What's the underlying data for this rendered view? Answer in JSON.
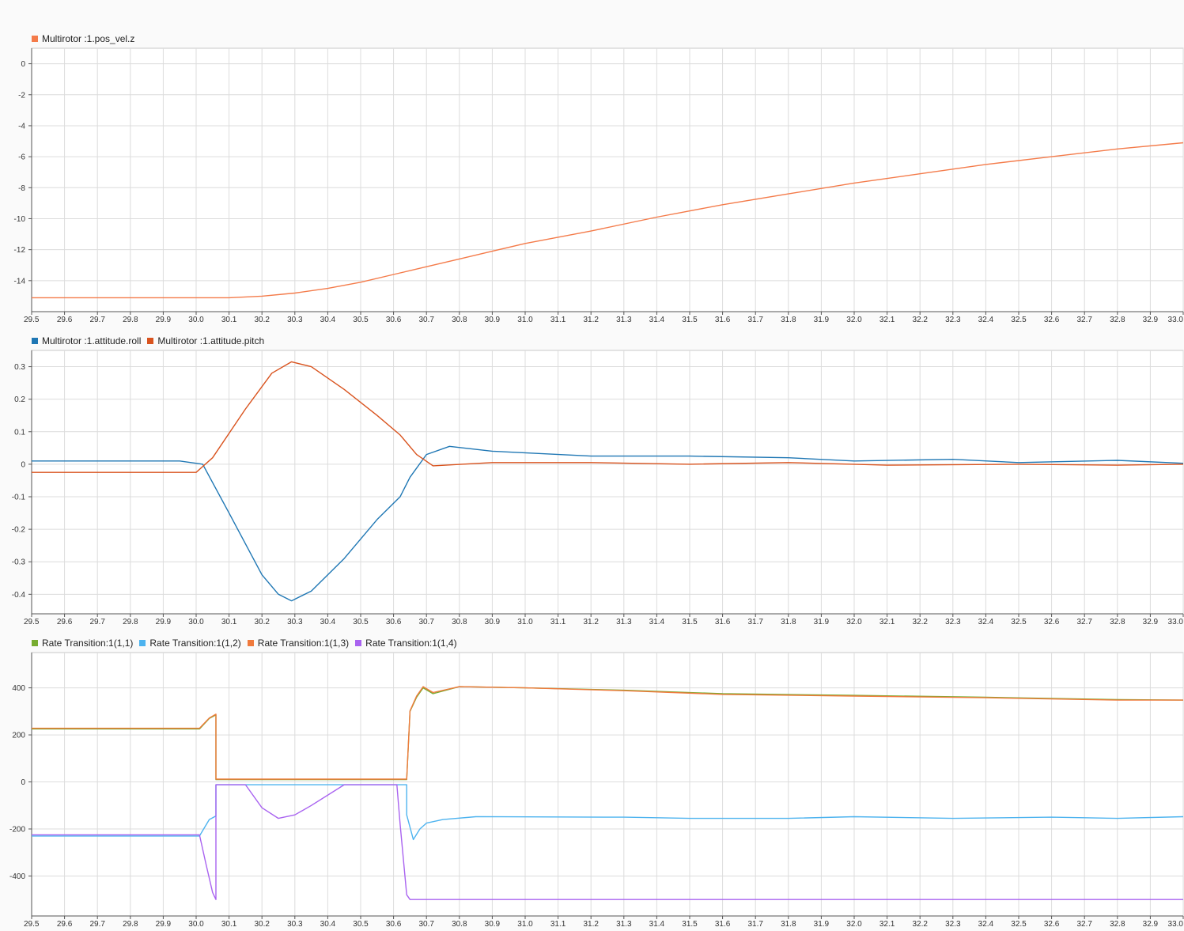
{
  "chart_data": [
    {
      "type": "line",
      "legend_placement": "top-left",
      "grid": true,
      "xlim": [
        29.5,
        33.0
      ],
      "ylim": [
        -16,
        1
      ],
      "xticks": [
        "29.5",
        "29.6",
        "29.7",
        "29.8",
        "29.9",
        "30.0",
        "30.1",
        "30.2",
        "30.3",
        "30.4",
        "30.5",
        "30.6",
        "30.7",
        "30.8",
        "30.9",
        "31.0",
        "31.1",
        "31.2",
        "31.3",
        "31.4",
        "31.5",
        "31.6",
        "31.7",
        "31.8",
        "31.9",
        "32.0",
        "32.1",
        "32.2",
        "32.3",
        "32.4",
        "32.5",
        "32.6",
        "32.7",
        "32.8",
        "32.9",
        "33.0"
      ],
      "yticks": [
        "0",
        "-2",
        "-4",
        "-6",
        "-8",
        "-10",
        "-12",
        "-14"
      ],
      "series": [
        {
          "name": "Multirotor :1.pos_vel.z",
          "color": "#f47b4a",
          "x": [
            29.5,
            30.1,
            30.2,
            30.3,
            30.4,
            30.5,
            30.6,
            30.7,
            30.8,
            30.9,
            31.0,
            31.2,
            31.4,
            31.6,
            31.8,
            32.0,
            32.2,
            32.4,
            32.6,
            32.8,
            33.0
          ],
          "y": [
            -15.1,
            -15.1,
            -15.0,
            -14.8,
            -14.5,
            -14.1,
            -13.6,
            -13.1,
            -12.6,
            -12.1,
            -11.6,
            -10.8,
            -9.9,
            -9.1,
            -8.4,
            -7.7,
            -7.1,
            -6.5,
            -6.0,
            -5.5,
            -5.1
          ]
        }
      ]
    },
    {
      "type": "line",
      "legend_placement": "top-left",
      "grid": true,
      "xlim": [
        29.5,
        33.0
      ],
      "ylim": [
        -0.46,
        0.35
      ],
      "xticks": [
        "29.5",
        "29.6",
        "29.7",
        "29.8",
        "29.9",
        "30.0",
        "30.1",
        "30.2",
        "30.3",
        "30.4",
        "30.5",
        "30.6",
        "30.7",
        "30.8",
        "30.9",
        "31.0",
        "31.1",
        "31.2",
        "31.3",
        "31.4",
        "31.5",
        "31.6",
        "31.7",
        "31.8",
        "31.9",
        "32.0",
        "32.1",
        "32.2",
        "32.3",
        "32.4",
        "32.5",
        "32.6",
        "32.7",
        "32.8",
        "32.9",
        "33.0"
      ],
      "yticks": [
        "0.3",
        "0.2",
        "0.1",
        "0",
        "-0.1",
        "-0.2",
        "-0.3",
        "-0.4"
      ],
      "series": [
        {
          "name": "Multirotor :1.attitude.roll",
          "color": "#1f77b4",
          "x": [
            29.5,
            29.95,
            30.02,
            30.1,
            30.2,
            30.25,
            30.29,
            30.35,
            30.45,
            30.55,
            30.62,
            30.65,
            30.7,
            30.77,
            30.9,
            31.2,
            31.5,
            31.8,
            32.0,
            32.3,
            32.5,
            32.8,
            33.0
          ],
          "y": [
            0.01,
            0.01,
            0.0,
            -0.15,
            -0.34,
            -0.4,
            -0.42,
            -0.39,
            -0.29,
            -0.17,
            -0.1,
            -0.04,
            0.03,
            0.055,
            0.04,
            0.025,
            0.025,
            0.02,
            0.01,
            0.015,
            0.005,
            0.012,
            0.003
          ]
        },
        {
          "name": "Multirotor :1.attitude.pitch",
          "color": "#d9531e",
          "x": [
            29.5,
            30.0,
            30.05,
            30.15,
            30.23,
            30.29,
            30.35,
            30.45,
            30.55,
            30.62,
            30.67,
            30.72,
            30.9,
            31.2,
            31.5,
            31.8,
            32.1,
            32.5,
            32.8,
            33.0
          ],
          "y": [
            -0.025,
            -0.025,
            0.02,
            0.17,
            0.28,
            0.315,
            0.3,
            0.23,
            0.15,
            0.09,
            0.03,
            -0.005,
            0.005,
            0.005,
            0.0,
            0.005,
            -0.003,
            0.0,
            -0.003,
            0.0
          ]
        }
      ]
    },
    {
      "type": "line",
      "legend_placement": "top-left",
      "grid": true,
      "xlim": [
        29.5,
        33.0
      ],
      "ylim": [
        -570,
        550
      ],
      "xticks": [
        "29.5",
        "29.6",
        "29.7",
        "29.8",
        "29.9",
        "30.0",
        "30.1",
        "30.2",
        "30.3",
        "30.4",
        "30.5",
        "30.6",
        "30.7",
        "30.8",
        "30.9",
        "31.0",
        "31.1",
        "31.2",
        "31.3",
        "31.4",
        "31.5",
        "31.6",
        "31.7",
        "31.8",
        "31.9",
        "32.0",
        "32.1",
        "32.2",
        "32.3",
        "32.4",
        "32.5",
        "32.6",
        "32.7",
        "32.8",
        "32.9",
        "33.0"
      ],
      "yticks": [
        "400",
        "200",
        "0",
        "-200",
        "-400"
      ],
      "series": [
        {
          "name": "Rate Transition:1(1,1)",
          "color": "#77ac30",
          "x": [
            29.5,
            30.01,
            30.04,
            30.06,
            30.06,
            30.64,
            30.65,
            30.67,
            30.69,
            30.72,
            30.8,
            31.0,
            31.3,
            31.6,
            32.0,
            32.4,
            32.8,
            33.0
          ],
          "y": [
            225,
            225,
            270,
            285,
            10,
            10,
            300,
            360,
            400,
            375,
            405,
            400,
            390,
            375,
            368,
            360,
            350,
            348
          ]
        },
        {
          "name": "Rate Transition:1(1,2)",
          "color": "#4db3ef",
          "x": [
            29.5,
            30.01,
            30.04,
            30.06,
            30.06,
            30.64,
            30.64,
            30.66,
            30.68,
            30.7,
            30.75,
            30.85,
            31.3,
            31.5,
            31.8,
            32.0,
            32.3,
            32.6,
            32.8,
            33.0
          ],
          "y": [
            -230,
            -230,
            -160,
            -145,
            -12,
            -12,
            -140,
            -245,
            -200,
            -175,
            -160,
            -148,
            -150,
            -155,
            -155,
            -148,
            -155,
            -150,
            -155,
            -148
          ]
        },
        {
          "name": "Rate Transition:1(1,3)",
          "color": "#f07a3c",
          "x": [
            29.5,
            30.01,
            30.04,
            30.06,
            30.06,
            30.64,
            30.65,
            30.67,
            30.69,
            30.72,
            30.8,
            31.0,
            31.3,
            31.6,
            32.0,
            32.4,
            32.8,
            33.0
          ],
          "y": [
            228,
            228,
            272,
            288,
            12,
            12,
            302,
            365,
            405,
            380,
            405,
            400,
            388,
            372,
            365,
            358,
            348,
            348
          ]
        },
        {
          "name": "Rate Transition:1(1,4)",
          "color": "#a963f0",
          "x": [
            29.5,
            30.01,
            30.03,
            30.05,
            30.06,
            30.06,
            30.15,
            30.2,
            30.25,
            30.3,
            30.35,
            30.45,
            30.61,
            30.62,
            30.64,
            30.65,
            33.0
          ],
          "y": [
            -225,
            -225,
            -350,
            -470,
            -500,
            -12,
            -12,
            -110,
            -155,
            -140,
            -100,
            -12,
            -12,
            -180,
            -480,
            -500,
            -500
          ]
        }
      ]
    }
  ]
}
